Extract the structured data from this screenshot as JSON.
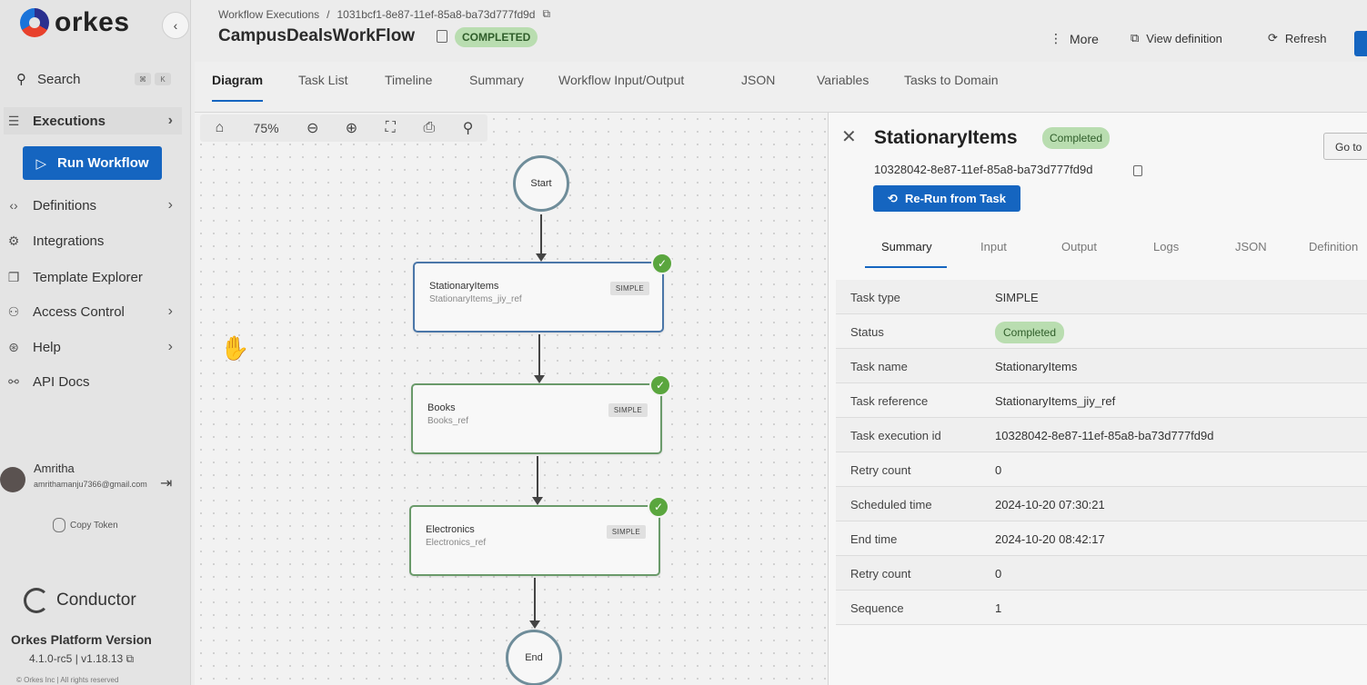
{
  "brand": {
    "name": "orkes",
    "colors": {
      "primary": "#1565c0",
      "success": "#5aa63e",
      "chip": "#b9ddb0"
    }
  },
  "sidebar": {
    "search_label": "Search",
    "search_keys": [
      "⌘",
      "K"
    ],
    "items": [
      {
        "label": "Executions",
        "icon": "list-icon",
        "chevron": true,
        "active": true
      },
      {
        "label": "Definitions",
        "icon": "code-icon",
        "chevron": true
      },
      {
        "label": "Integrations",
        "icon": "integrations-icon",
        "chevron": false
      },
      {
        "label": "Template Explorer",
        "icon": "template-icon",
        "chevron": false
      },
      {
        "label": "Access Control",
        "icon": "access-icon",
        "chevron": true
      },
      {
        "label": "Help",
        "icon": "help-icon",
        "chevron": true
      },
      {
        "label": "API Docs",
        "icon": "api-icon",
        "chevron": false
      }
    ],
    "run_workflow_label": "Run Workflow",
    "user": {
      "name": "Amritha",
      "email": "amrithamanju7366@gmail.com"
    },
    "copy_token_label": "Copy Token",
    "conductor_label": "Conductor",
    "version_title": "Orkes Platform Version",
    "version": "4.1.0-rc5 | v1.18.13",
    "copyright": "© Orkes Inc | All rights reserved"
  },
  "header": {
    "breadcrumb_parent": "Workflow Executions",
    "breadcrumb_sep": "/",
    "breadcrumb_id": "1031bcf1-8e87-11ef-85a8-ba73d777fd9d",
    "workflow_name": "CampusDealsWorkFlow",
    "status": "COMPLETED",
    "more_label": "More",
    "view_definition_label": "View definition",
    "refresh_label": "Refresh"
  },
  "tabs": [
    "Diagram",
    "Task List",
    "Timeline",
    "Summary",
    "Workflow Input/Output",
    "JSON",
    "Variables",
    "Tasks to Domain"
  ],
  "toolbar": {
    "zoom": "75%"
  },
  "diagram": {
    "start_label": "Start",
    "end_label": "End",
    "tasks": [
      {
        "name": "StationaryItems",
        "ref": "StationaryItems_jiy_ref",
        "type": "SIMPLE",
        "status": "completed"
      },
      {
        "name": "Books",
        "ref": "Books_ref",
        "type": "SIMPLE",
        "status": "completed"
      },
      {
        "name": "Electronics",
        "ref": "Electronics_ref",
        "type": "SIMPLE",
        "status": "completed"
      }
    ]
  },
  "panel": {
    "title": "StationaryItems",
    "status": "Completed",
    "task_id": "10328042-8e87-11ef-85a8-ba73d777fd9d",
    "goto_label": "Go to",
    "rerun_label": "Re-Run from Task",
    "tabs": [
      "Summary",
      "Input",
      "Output",
      "Logs",
      "JSON",
      "Definition"
    ],
    "rows": [
      {
        "key": "Task type",
        "value": "SIMPLE"
      },
      {
        "key": "Status",
        "value": "Completed",
        "chip": true
      },
      {
        "key": "Task name",
        "value": "StationaryItems"
      },
      {
        "key": "Task reference",
        "value": "StationaryItems_jiy_ref"
      },
      {
        "key": "Task execution id",
        "value": "10328042-8e87-11ef-85a8-ba73d777fd9d"
      },
      {
        "key": "Retry count",
        "value": "0"
      },
      {
        "key": "Scheduled time",
        "value": "2024-10-20 07:30:21"
      },
      {
        "key": "End time",
        "value": "2024-10-20 08:42:17"
      },
      {
        "key": "Retry count",
        "value": "0"
      },
      {
        "key": "Sequence",
        "value": "1"
      }
    ]
  }
}
